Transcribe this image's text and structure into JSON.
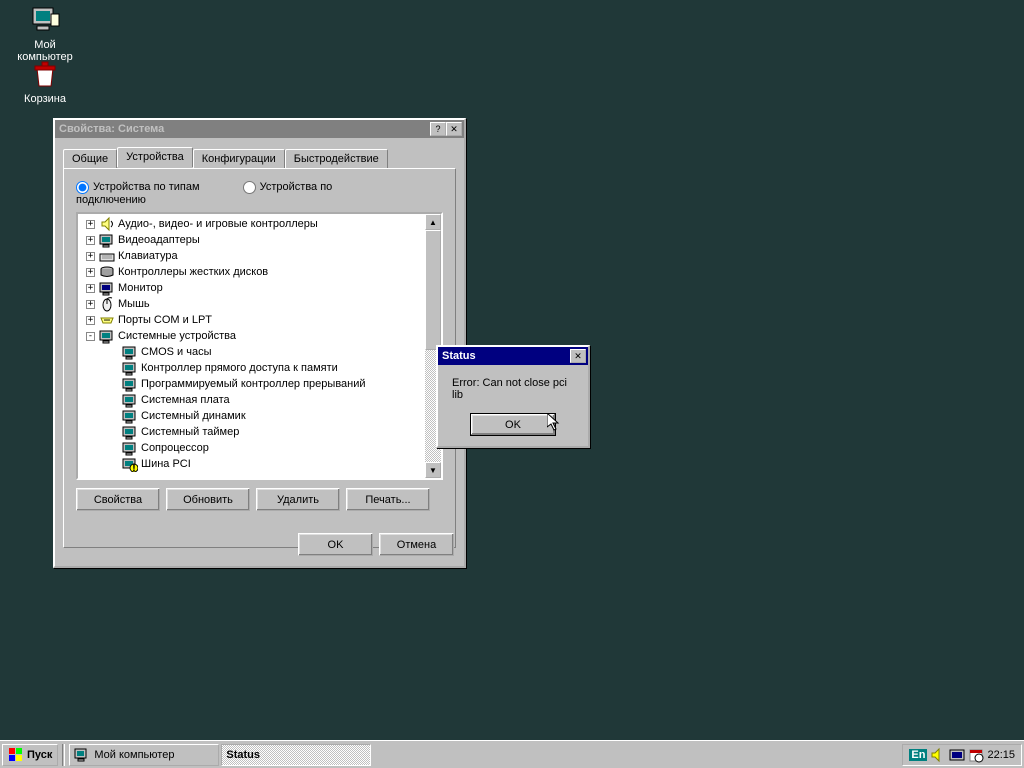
{
  "desktop": {
    "my_computer": "Мой компьютер",
    "recycle_bin": "Корзина"
  },
  "system_properties": {
    "title": "Свойства: Система",
    "tabs": [
      "Общие",
      "Устройства",
      "Конфигурации",
      "Быстродействие"
    ],
    "active_tab": 1,
    "radio": {
      "by_type": "Устройства по типам",
      "by_connection": "Устройства по подключению"
    },
    "tree": [
      {
        "label": "Аудио-, видео- и игровые контроллеры",
        "expand": "+",
        "icon": "audio"
      },
      {
        "label": "Видеоадаптеры",
        "expand": "+",
        "icon": "display"
      },
      {
        "label": "Клавиатура",
        "expand": "+",
        "icon": "keyboard"
      },
      {
        "label": "Контроллеры жестких дисков",
        "expand": "+",
        "icon": "hdd"
      },
      {
        "label": "Монитор",
        "expand": "+",
        "icon": "monitor"
      },
      {
        "label": "Мышь",
        "expand": "+",
        "icon": "mouse"
      },
      {
        "label": "Порты COM и LPT",
        "expand": "+",
        "icon": "port"
      },
      {
        "label": "Системные устройства",
        "expand": "-",
        "icon": "system"
      }
    ],
    "tree_children": [
      {
        "label": "CMOS и часы"
      },
      {
        "label": "Контроллер прямого доступа к памяти"
      },
      {
        "label": "Программируемый контроллер прерываний"
      },
      {
        "label": "Системная плата"
      },
      {
        "label": "Системный динамик"
      },
      {
        "label": "Системный таймер"
      },
      {
        "label": "Сопроцессор"
      },
      {
        "label": "Шина PCI",
        "warn": true
      }
    ],
    "buttons": {
      "properties": "Свойства",
      "refresh": "Обновить",
      "delete": "Удалить",
      "print": "Печать..."
    },
    "ok": "OK",
    "cancel": "Отмена"
  },
  "status_dialog": {
    "title": "Status",
    "message": "Error: Can not close pci lib",
    "ok": "OK"
  },
  "taskbar": {
    "start": "Пуск",
    "tasks": [
      {
        "label": "Мой компьютер",
        "active": false
      },
      {
        "label": "Status",
        "active": true
      }
    ],
    "lang": "En",
    "clock": "22:15"
  }
}
